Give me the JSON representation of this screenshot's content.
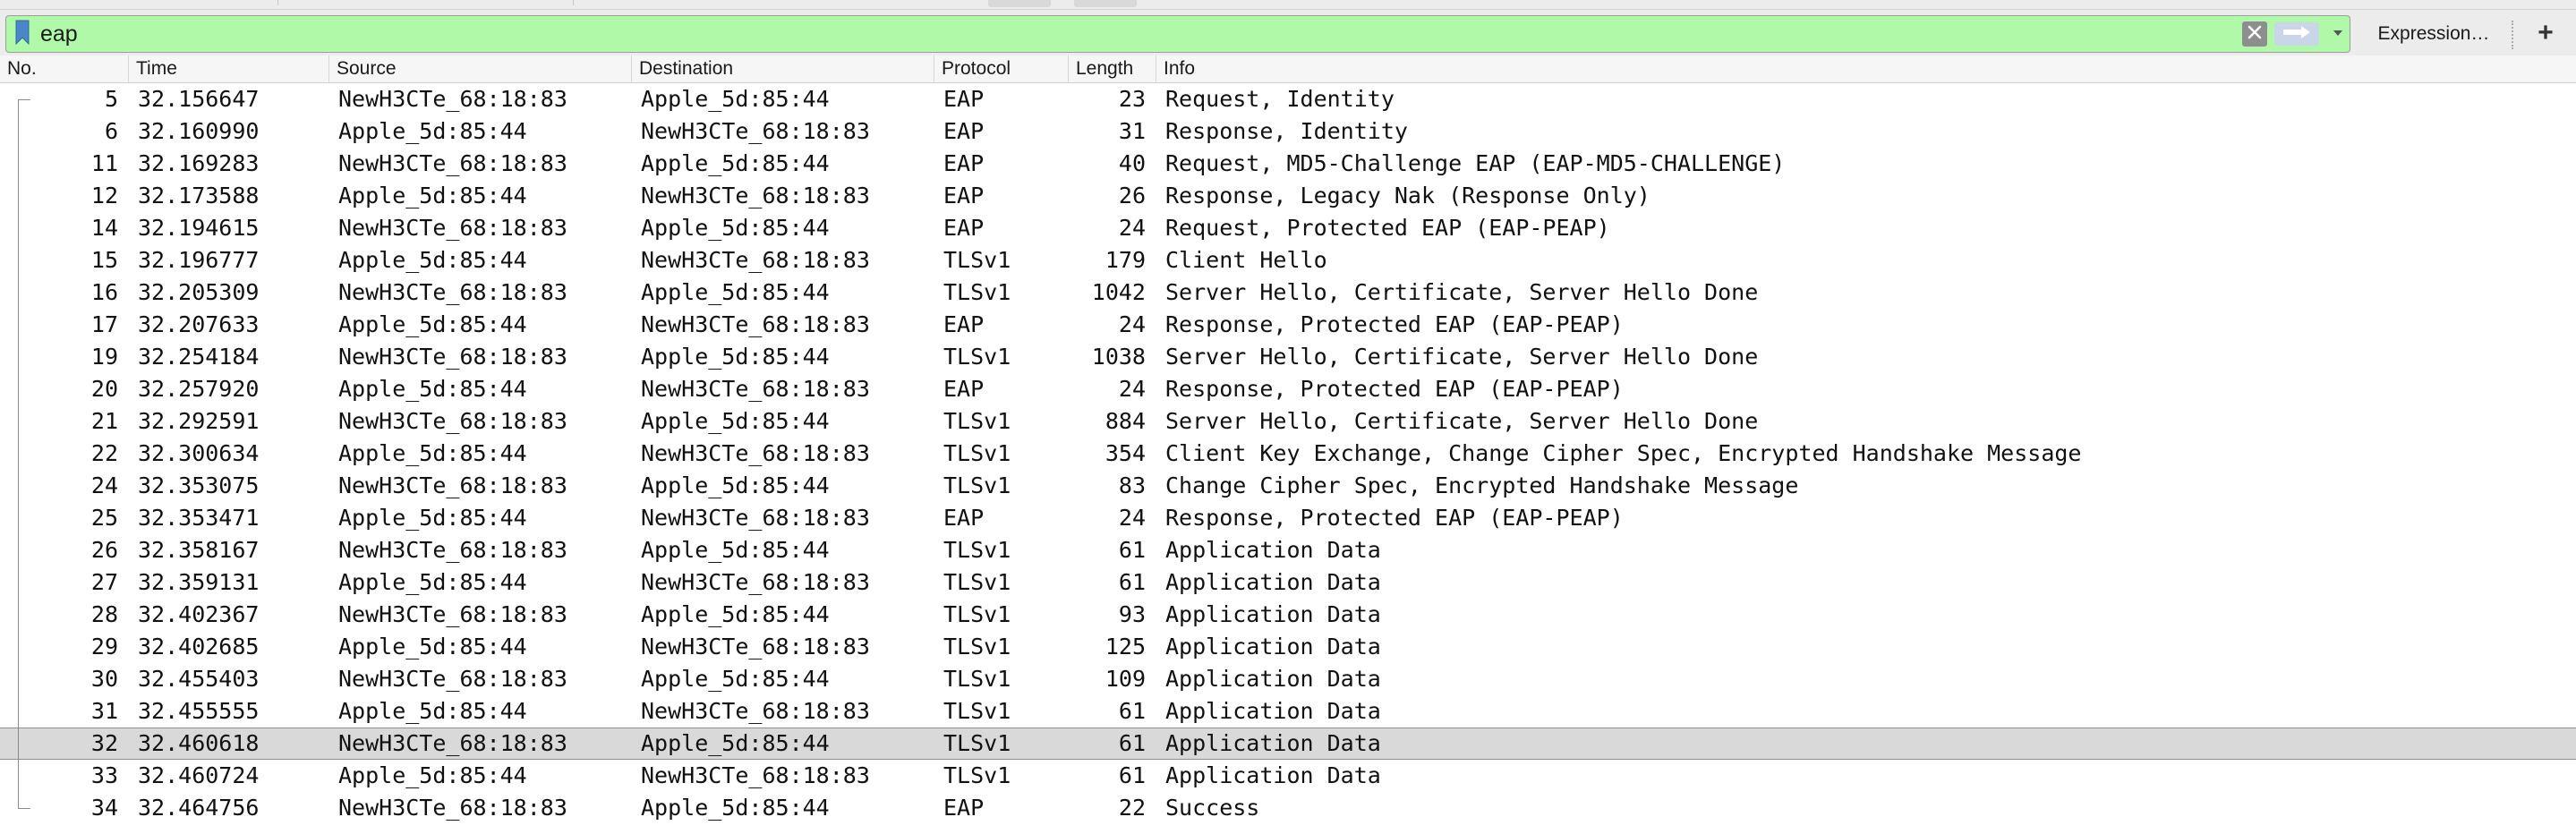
{
  "filter": {
    "value": "eap",
    "expression_label": "Expression…",
    "add_label": "+",
    "background": "#aff9a8"
  },
  "icons": {
    "bookmark": "bookmark-icon",
    "clear": "clear-filter-icon",
    "apply": "apply-arrow-icon",
    "dropdown": "chevron-down-icon"
  },
  "columns": {
    "no": "No.",
    "time": "Time",
    "source": "Source",
    "destination": "Destination",
    "protocol": "Protocol",
    "length": "Length",
    "info": "Info"
  },
  "selected_row": 21,
  "packets": [
    {
      "no": "5",
      "time": "32.156647",
      "source": "NewH3CTe_68:18:83",
      "destination": "Apple_5d:85:44",
      "protocol": "EAP",
      "length": "23",
      "info": "Request, Identity"
    },
    {
      "no": "6",
      "time": "32.160990",
      "source": "Apple_5d:85:44",
      "destination": "NewH3CTe_68:18:83",
      "protocol": "EAP",
      "length": "31",
      "info": "Response, Identity"
    },
    {
      "no": "11",
      "time": "32.169283",
      "source": "NewH3CTe_68:18:83",
      "destination": "Apple_5d:85:44",
      "protocol": "EAP",
      "length": "40",
      "info": "Request, MD5-Challenge EAP (EAP-MD5-CHALLENGE)"
    },
    {
      "no": "12",
      "time": "32.173588",
      "source": "Apple_5d:85:44",
      "destination": "NewH3CTe_68:18:83",
      "protocol": "EAP",
      "length": "26",
      "info": "Response, Legacy Nak (Response Only)"
    },
    {
      "no": "14",
      "time": "32.194615",
      "source": "NewH3CTe_68:18:83",
      "destination": "Apple_5d:85:44",
      "protocol": "EAP",
      "length": "24",
      "info": "Request, Protected EAP (EAP-PEAP)"
    },
    {
      "no": "15",
      "time": "32.196777",
      "source": "Apple_5d:85:44",
      "destination": "NewH3CTe_68:18:83",
      "protocol": "TLSv1",
      "length": "179",
      "info": "Client Hello"
    },
    {
      "no": "16",
      "time": "32.205309",
      "source": "NewH3CTe_68:18:83",
      "destination": "Apple_5d:85:44",
      "protocol": "TLSv1",
      "length": "1042",
      "info": "Server Hello, Certificate, Server Hello Done"
    },
    {
      "no": "17",
      "time": "32.207633",
      "source": "Apple_5d:85:44",
      "destination": "NewH3CTe_68:18:83",
      "protocol": "EAP",
      "length": "24",
      "info": "Response, Protected EAP (EAP-PEAP)"
    },
    {
      "no": "19",
      "time": "32.254184",
      "source": "NewH3CTe_68:18:83",
      "destination": "Apple_5d:85:44",
      "protocol": "TLSv1",
      "length": "1038",
      "info": "Server Hello, Certificate, Server Hello Done"
    },
    {
      "no": "20",
      "time": "32.257920",
      "source": "Apple_5d:85:44",
      "destination": "NewH3CTe_68:18:83",
      "protocol": "EAP",
      "length": "24",
      "info": "Response, Protected EAP (EAP-PEAP)"
    },
    {
      "no": "21",
      "time": "32.292591",
      "source": "NewH3CTe_68:18:83",
      "destination": "Apple_5d:85:44",
      "protocol": "TLSv1",
      "length": "884",
      "info": "Server Hello, Certificate, Server Hello Done"
    },
    {
      "no": "22",
      "time": "32.300634",
      "source": "Apple_5d:85:44",
      "destination": "NewH3CTe_68:18:83",
      "protocol": "TLSv1",
      "length": "354",
      "info": "Client Key Exchange, Change Cipher Spec, Encrypted Handshake Message"
    },
    {
      "no": "24",
      "time": "32.353075",
      "source": "NewH3CTe_68:18:83",
      "destination": "Apple_5d:85:44",
      "protocol": "TLSv1",
      "length": "83",
      "info": "Change Cipher Spec, Encrypted Handshake Message"
    },
    {
      "no": "25",
      "time": "32.353471",
      "source": "Apple_5d:85:44",
      "destination": "NewH3CTe_68:18:83",
      "protocol": "EAP",
      "length": "24",
      "info": "Response, Protected EAP (EAP-PEAP)"
    },
    {
      "no": "26",
      "time": "32.358167",
      "source": "NewH3CTe_68:18:83",
      "destination": "Apple_5d:85:44",
      "protocol": "TLSv1",
      "length": "61",
      "info": "Application Data"
    },
    {
      "no": "27",
      "time": "32.359131",
      "source": "Apple_5d:85:44",
      "destination": "NewH3CTe_68:18:83",
      "protocol": "TLSv1",
      "length": "61",
      "info": "Application Data"
    },
    {
      "no": "28",
      "time": "32.402367",
      "source": "NewH3CTe_68:18:83",
      "destination": "Apple_5d:85:44",
      "protocol": "TLSv1",
      "length": "93",
      "info": "Application Data"
    },
    {
      "no": "29",
      "time": "32.402685",
      "source": "Apple_5d:85:44",
      "destination": "NewH3CTe_68:18:83",
      "protocol": "TLSv1",
      "length": "125",
      "info": "Application Data"
    },
    {
      "no": "30",
      "time": "32.455403",
      "source": "NewH3CTe_68:18:83",
      "destination": "Apple_5d:85:44",
      "protocol": "TLSv1",
      "length": "109",
      "info": "Application Data"
    },
    {
      "no": "31",
      "time": "32.455555",
      "source": "Apple_5d:85:44",
      "destination": "NewH3CTe_68:18:83",
      "protocol": "TLSv1",
      "length": "61",
      "info": "Application Data"
    },
    {
      "no": "32",
      "time": "32.460618",
      "source": "NewH3CTe_68:18:83",
      "destination": "Apple_5d:85:44",
      "protocol": "TLSv1",
      "length": "61",
      "info": "Application Data"
    },
    {
      "no": "33",
      "time": "32.460724",
      "source": "Apple_5d:85:44",
      "destination": "NewH3CTe_68:18:83",
      "protocol": "TLSv1",
      "length": "61",
      "info": "Application Data"
    },
    {
      "no": "34",
      "time": "32.464756",
      "source": "NewH3CTe_68:18:83",
      "destination": "Apple_5d:85:44",
      "protocol": "EAP",
      "length": "22",
      "info": "Success"
    }
  ]
}
